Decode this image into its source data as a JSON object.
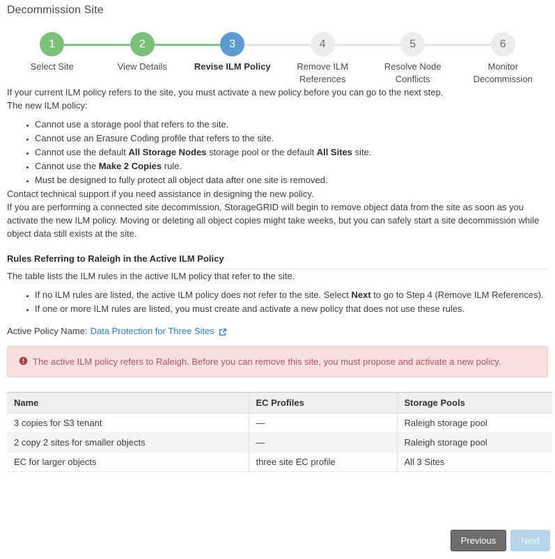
{
  "page": {
    "title": "Decommission Site"
  },
  "stepper": {
    "steps": [
      {
        "number": "1",
        "label": "Select Site",
        "state": "done"
      },
      {
        "number": "2",
        "label": "View Details",
        "state": "done"
      },
      {
        "number": "3",
        "label": "Revise ILM Policy",
        "state": "current"
      },
      {
        "number": "4",
        "label": "Remove ILM References",
        "state": "todo"
      },
      {
        "number": "5",
        "label": "Resolve Node Conflicts",
        "state": "todo"
      },
      {
        "number": "6",
        "label": "Monitor Decommission",
        "state": "todo"
      }
    ]
  },
  "intro": {
    "paragraph1": "If your current ILM policy refers to the site, you must activate a new policy before you can go to the next step.",
    "paragraph2": "The new ILM policy:",
    "bullets": [
      {
        "pre": "Cannot use a storage pool that refers to the site.",
        "bold": "",
        "post": ""
      },
      {
        "pre": "Cannot use an Erasure Coding profile that refers to the site.",
        "bold": "",
        "post": ""
      },
      {
        "pre": "Cannot use the default ",
        "bold": "All Storage Nodes",
        "mid": " storage pool or the default ",
        "bold2": "All Sites",
        "post": " site."
      },
      {
        "pre": "Cannot use the ",
        "bold": "Make 2 Copies",
        "post": " rule."
      },
      {
        "pre": "Must be designed to fully protect all object data after one site is removed.",
        "bold": "",
        "post": ""
      }
    ],
    "paragraph3": "Contact technical support if you need assistance in designing the new policy.",
    "paragraph4": "If you are performing a connected site decommission, StorageGRID will begin to remove object data from the site as soon as you activate the new ILM policy. Moving or deleting all object copies might take weeks, but you can safely start a site decommission while object data still exists at the site."
  },
  "rules_section": {
    "heading": "Rules Referring to Raleigh in the Active ILM Policy",
    "paragraph": "The table lists the ILM rules in the active ILM policy that refer to the site.",
    "bullet1_pre": "If no ILM rules are listed, the active ILM policy does not refer to the site. Select ",
    "bullet1_bold": "Next",
    "bullet1_post": " to go to Step 4 (Remove ILM References).",
    "bullet2": "If one or more ILM rules are listed, you must create and activate a new policy that does not use these rules.",
    "active_policy_label": "Active Policy Name:",
    "active_policy_name": "Data Protection for Three Sites",
    "external_link_icon": "external-link-icon"
  },
  "alert": {
    "icon": "error-circle-icon",
    "message": "The active ILM policy refers to Raleigh. Before you can remove this site, you must propose and activate a new policy.",
    "background_color": "#f8e0e1",
    "border_color": "#f0cdcf",
    "text_color": "#b0565c"
  },
  "table": {
    "columns": [
      "Name",
      "EC Profiles",
      "Storage Pools"
    ],
    "rows": [
      {
        "name": "3 copies for S3 tenant",
        "ec_profiles": "—",
        "storage_pools": "Raleigh storage pool"
      },
      {
        "name": "2 copy 2 sites for smaller objects",
        "ec_profiles": "—",
        "storage_pools": "Raleigh storage pool"
      },
      {
        "name": "EC for larger objects",
        "ec_profiles": "three site EC profile",
        "storage_pools": "All 3 Sites"
      }
    ]
  },
  "footer": {
    "previous_label": "Previous",
    "next_label": "Next"
  },
  "colors": {
    "step_done": "#7cc07c",
    "step_current": "#5c9bd1",
    "step_todo": "#ececec",
    "link": "#2f7dc0",
    "button_previous": "#6d6d6d",
    "button_next": "#b8d6ea"
  }
}
